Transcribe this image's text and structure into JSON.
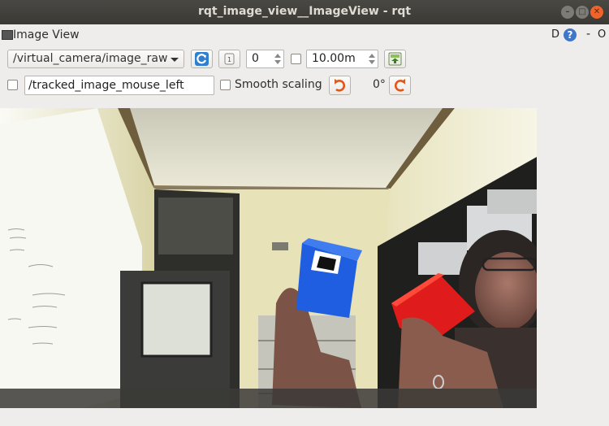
{
  "window": {
    "title": "rqt_image_view__ImageView - rqt"
  },
  "plugin": {
    "title": "Image View",
    "d_label": "D",
    "help_label": "?",
    "min_label": "-",
    "float_label": "O"
  },
  "toolbar": {
    "topic": "/virtual_camera/image_raw",
    "rotation_spin_value": "0",
    "max_depth_value": "10.00m"
  },
  "row2": {
    "mouse_topic": "/tracked_image_mouse_left",
    "smooth_label": "Smooth scaling",
    "rotation_label": "0°"
  },
  "colors": {
    "accent_blue": "#2f7fd0",
    "rotate_orange": "#e0571a",
    "cube_blue": "#1f5ee0",
    "cube_red": "#e01b1b"
  }
}
